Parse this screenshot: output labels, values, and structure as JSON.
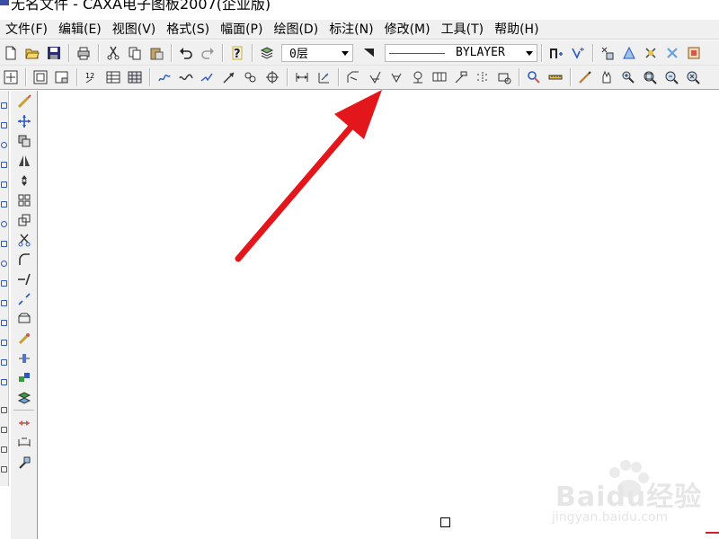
{
  "window": {
    "title": "无名文件 - CAXA电子图板2007(企业版)"
  },
  "menu": [
    "文件(F)",
    "编辑(E)",
    "视图(V)",
    "格式(S)",
    "幅面(P)",
    "绘图(D)",
    "标注(N)",
    "修改(M)",
    "工具(T)",
    "帮助(H)"
  ],
  "toolbar": {
    "layer_value": "0层",
    "linetype_value": "BYLAYER",
    "line_color": "#c0262c"
  },
  "annotation": {
    "arrow_color": "#e3161c"
  },
  "watermark": {
    "brand": "Baidu经验",
    "url": "jingyan.baidu.com"
  }
}
